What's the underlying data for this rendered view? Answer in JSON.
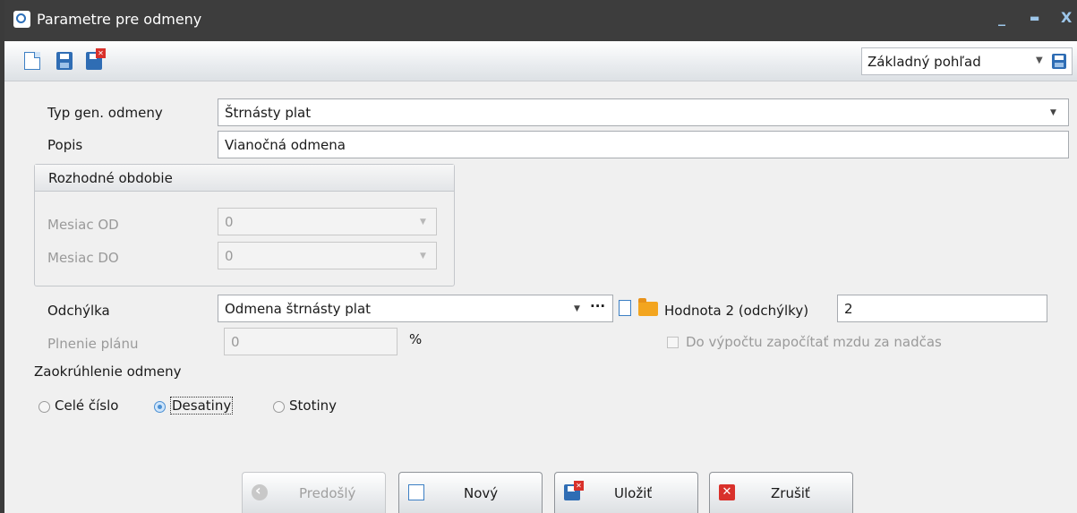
{
  "window": {
    "title": "Parametre pre odmeny",
    "minimize": "_",
    "maximize": "▬",
    "close": "X"
  },
  "toolbar": {
    "icons": [
      "new-document-icon",
      "save-icon",
      "save-and-close-icon"
    ],
    "view_select": {
      "value": "Základný pohľad",
      "icon": "save-icon"
    }
  },
  "form": {
    "typ": {
      "label": "Typ gen. odmeny",
      "value": "Štrnásty plat"
    },
    "popis": {
      "label": "Popis",
      "value": "Vianočná odmena"
    },
    "rozhodne_obdobie": {
      "title": "Rozhodné obdobie",
      "mesiac_od": {
        "label": "Mesiac OD",
        "value": "0"
      },
      "mesiac_do": {
        "label": "Mesiac DO",
        "value": "0"
      }
    },
    "odchylka": {
      "label": "Odchýlka",
      "value": "Odmena štrnásty plat",
      "ellipsis": "···"
    },
    "hodnota2": {
      "label": "Hodnota 2 (odchýlky)",
      "value": "2"
    },
    "plnenie": {
      "label": "Plnenie plánu",
      "value": "0",
      "unit": "%"
    },
    "nadcas": {
      "label": "Do výpočtu započítať mzdu za nadčas",
      "checked": false
    },
    "zaokruhlenie": {
      "label": "Zaokrúhlenie odmeny",
      "options": [
        "Celé číslo",
        "Desatiny",
        "Stotiny"
      ],
      "selected": "Desatiny"
    }
  },
  "buttons": {
    "prev": "Predošlý",
    "new": "Nový",
    "save": "Uložiť",
    "cancel": "Zrušiť"
  }
}
